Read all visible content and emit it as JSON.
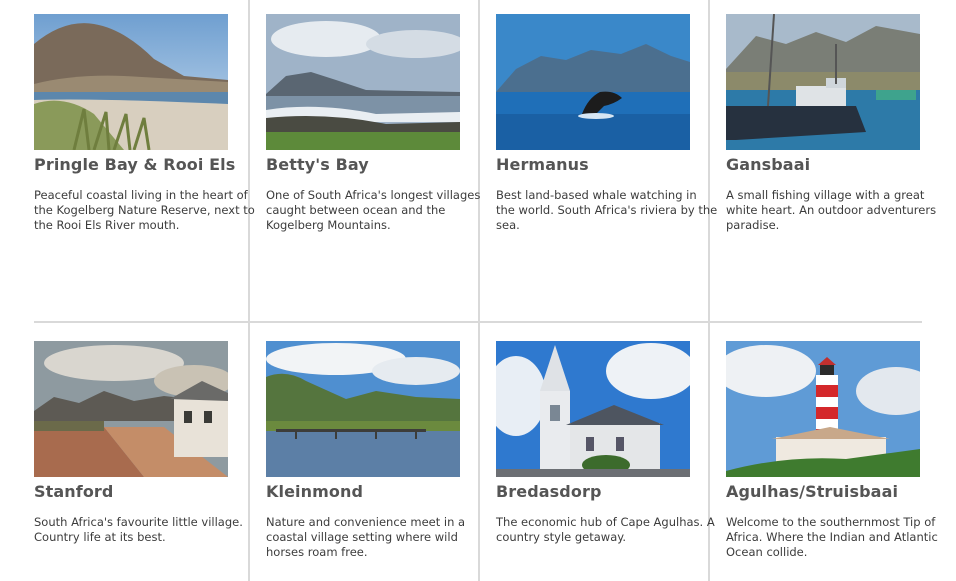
{
  "destinations": [
    {
      "name": "Pringle Bay & Rooi Els",
      "description": "Peaceful coastal living in the heart of the Kogelberg Nature Reserve, next to the Rooi Els River mouth."
    },
    {
      "name": "Betty's Bay",
      "description": "One of South Africa's longest villages caught between ocean and the Kogelberg Mountains."
    },
    {
      "name": "Hermanus",
      "description": "Best land-based whale watching in the world. South Africa's riviera by the sea."
    },
    {
      "name": "Gansbaai",
      "description": "A small fishing village with a great white heart. An outdoor adventurers paradise."
    },
    {
      "name": "Stanford",
      "description": "South Africa's favourite little village. Country life at its best."
    },
    {
      "name": "Kleinmond",
      "description": "Nature and convenience meet in a coastal village setting where wild horses roam free."
    },
    {
      "name": "Bredasdorp",
      "description": "The economic hub of Cape Agulhas. A country style getaway."
    },
    {
      "name": "Agulhas/Struisbaai",
      "description": "Welcome to the southernmost Tip of Africa. Where the Indian and Atlantic Ocean collide."
    }
  ]
}
